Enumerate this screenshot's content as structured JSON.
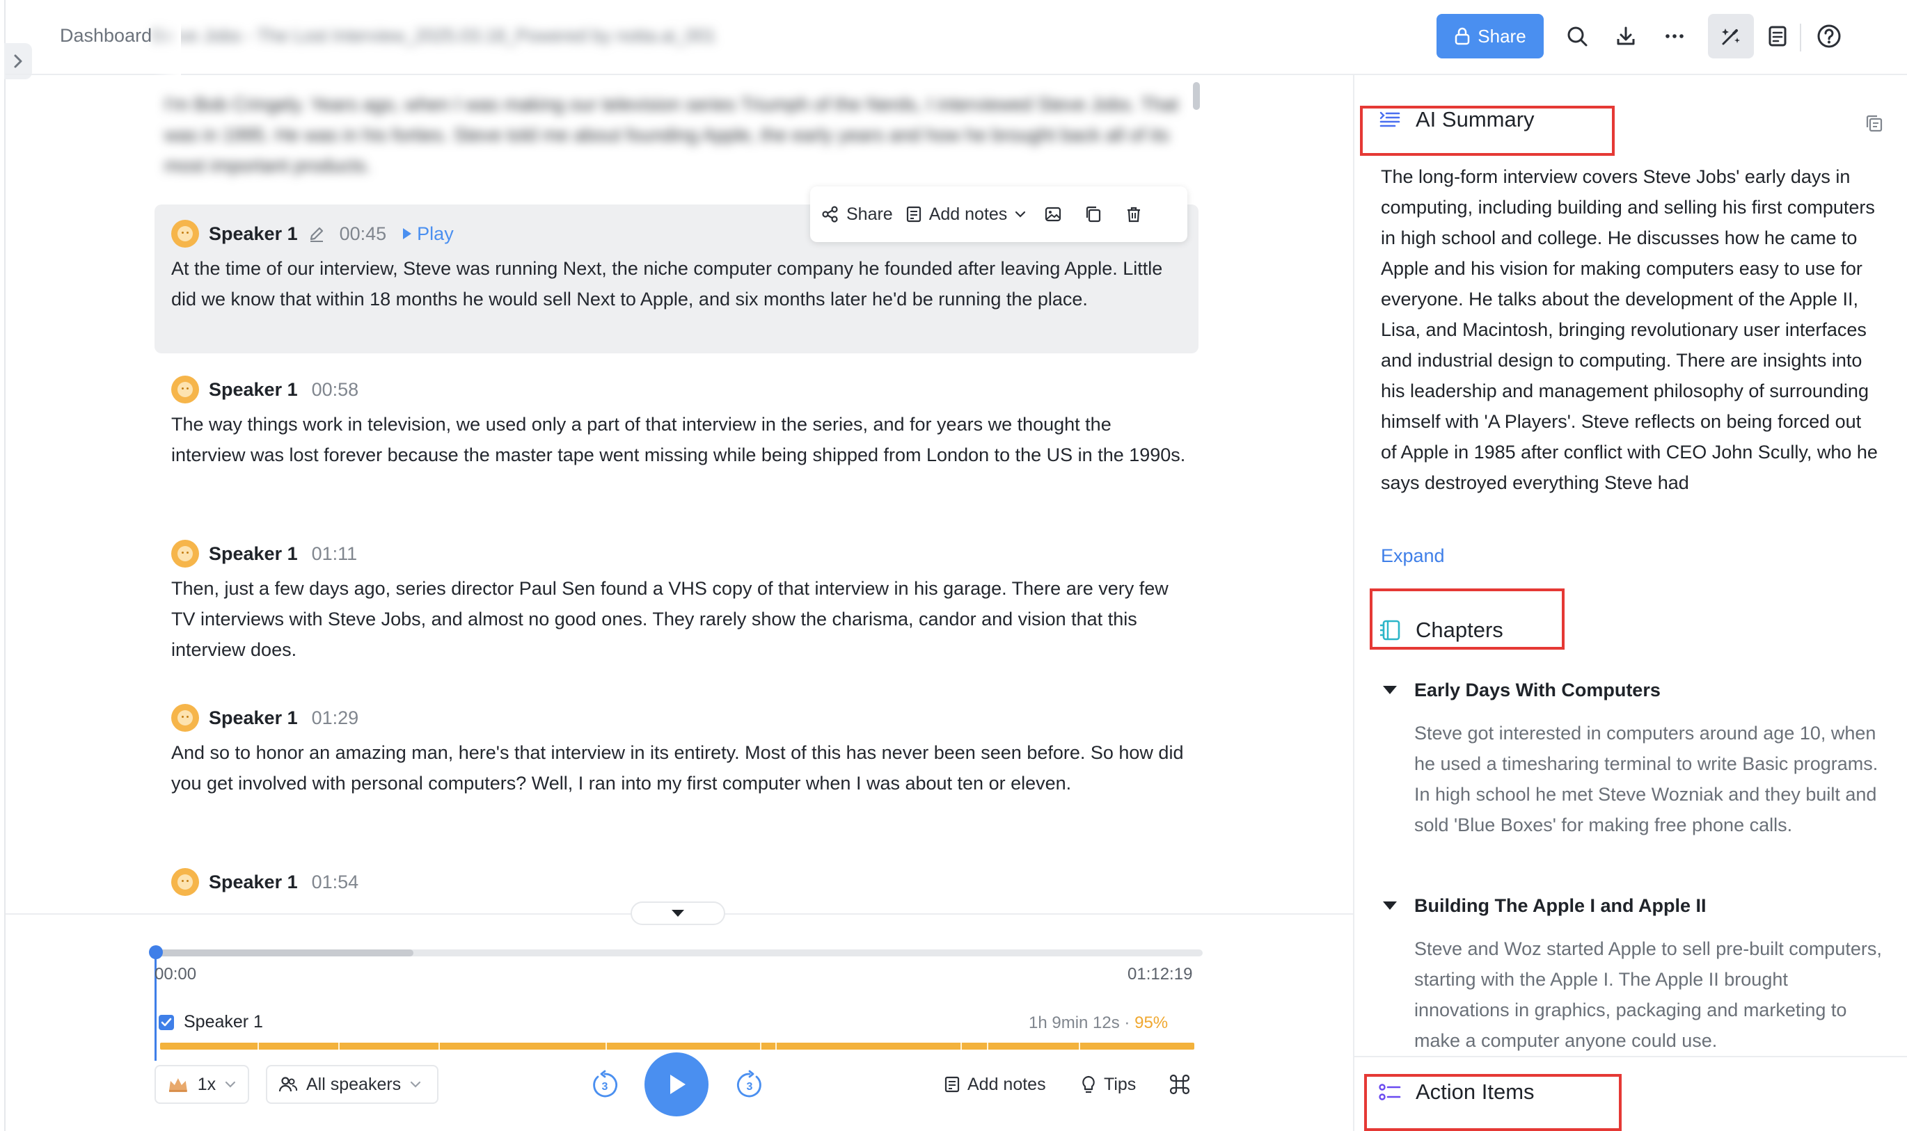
{
  "header": {
    "breadcrumb": "Dashboard",
    "file_title": "Steve Jobs - The Lost Interview_2025.03.18_Powered by notta.ai_001",
    "share_label": "Share",
    "icons": [
      "lock-icon",
      "search-icon",
      "download-icon",
      "more-icon",
      "ai-tools-icon",
      "notes-icon",
      "help-icon"
    ]
  },
  "transcript": {
    "blurred_intro": "I'm Bob Cringely. Years ago, when I was making our television series Triumph of the Nerds, I interviewed Steve Jobs. That was in 1995. He was in his forties. Steve told me about founding Apple, the early years and how he brought back all of its most important products.",
    "toolbar": {
      "share": "Share",
      "add_notes": "Add notes"
    },
    "play_label": "Play",
    "segments": [
      {
        "speaker": "Speaker 1",
        "time": "00:45",
        "text": "At the time of our interview, Steve was running Next, the niche computer company he founded after leaving Apple. Little did we know that within 18 months he would sell Next to Apple, and six months later he'd be running the place."
      },
      {
        "speaker": "Speaker 1",
        "time": "00:58",
        "text": "The way things work in television, we used only a part of that interview in the series, and for years we thought the interview was lost forever because the master tape went missing while being shipped from London to the US in the 1990s."
      },
      {
        "speaker": "Speaker 1",
        "time": "01:11",
        "text": "Then, just a few days ago, series director Paul Sen found a VHS copy of that interview in his garage. There are very few TV interviews with Steve Jobs, and almost no good ones. They rarely show the charisma, candor and vision that this interview does."
      },
      {
        "speaker": "Speaker 1",
        "time": "01:29",
        "text": "And so to honor an amazing man, here's that interview in its entirety. Most of this has never been seen before. So how did you get involved with personal computers? Well, I ran into my first computer when I was about ten or eleven."
      },
      {
        "speaker": "Speaker 1",
        "time": "01:54",
        "text": ""
      }
    ]
  },
  "player": {
    "current_time": "00:00",
    "total_time": "01:12:19",
    "progress": 0.0,
    "buffered": 0.25,
    "speaker_filter": "Speaker 1",
    "speaker_duration": "1h 9min 12s",
    "speaker_separator": "·",
    "speaker_percent": "95%",
    "speed": "1x",
    "speakers_select": "All speakers",
    "skip_seconds": "3",
    "add_notes": "Add notes",
    "tips": "Tips"
  },
  "right_panel": {
    "ai_summary_title": "AI Summary",
    "summary_text": "The long-form interview covers Steve Jobs' early days in computing, including building and selling his first computers in high school and college. He discusses how he came to Apple and his vision for making computers easy to use for everyone. He talks about the development of the Apple II, Lisa, and Macintosh, bringing revolutionary user interfaces and industrial design to computing. There are insights into his leadership and management philosophy of surrounding himself with 'A Players'. Steve reflects on being forced out of Apple in 1985 after conflict with CEO John Scully, who he says destroyed everything Steve had",
    "expand_label": "Expand",
    "chapters_title": "Chapters",
    "chapters": [
      {
        "title": "Early Days With Computers",
        "body": "Steve got interested in computers around age 10, when he used a timesharing terminal to write Basic programs. In high school he met Steve Wozniak and they built and sold 'Blue Boxes' for making free phone calls."
      },
      {
        "title": "Building The Apple I and Apple II",
        "body": "Steve and Woz started Apple to sell pre-built computers, starting with the Apple I. The Apple II brought innovations in graphics, packaging and marketing to make a computer anyone could use."
      }
    ],
    "action_items_title": "Action Items",
    "highlight_color": "#e53935",
    "accent_color": "#4a8ff0"
  }
}
